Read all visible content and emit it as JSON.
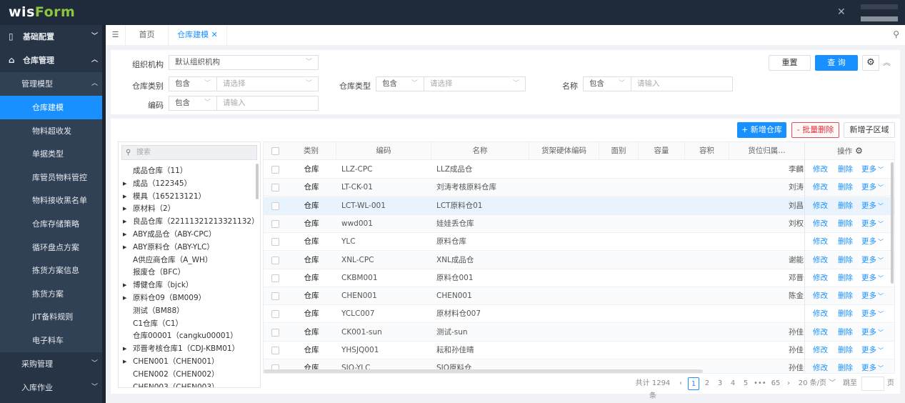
{
  "app": {
    "logo_a": "wis",
    "logo_b": "Form",
    "tool_icon": "tools-icon"
  },
  "sidebar": {
    "groups": [
      {
        "label": "基础配置"
      },
      {
        "label": "仓库管理"
      }
    ],
    "sub": "管理模型",
    "items": [
      "仓库建模",
      "物料超收发",
      "单据类型",
      "库管员物料管控",
      "物料接收黑名单",
      "仓库存储策略",
      "循环盘点方案",
      "拣货方案信息",
      "拣货方案",
      "JIT备料规则",
      "电子料车"
    ],
    "bottom": [
      "采购管理",
      "入库作业"
    ]
  },
  "tabs": {
    "home": "首页",
    "active": "仓库建模"
  },
  "filters": {
    "org_label": "组织机构",
    "org_value": "默认组织机构",
    "type_label": "仓库类别",
    "op": "包含",
    "select_ph": "请选择",
    "input_ph": "请输入",
    "wtype_label": "仓库类型",
    "name_label": "名称",
    "code_label": "编码",
    "reset": "重置",
    "query": "查 询"
  },
  "actions": {
    "add": "+ 新增仓库",
    "batch_delete": "- 批量删除",
    "add_sub": "新增子区域"
  },
  "tree": {
    "search_ph": "搜索",
    "nodes": [
      {
        "t": "成品仓库（11）",
        "c": false
      },
      {
        "t": "成品（122345）",
        "c": true
      },
      {
        "t": "模具（165213121）",
        "c": true
      },
      {
        "t": "原材料（2）",
        "c": true
      },
      {
        "t": "良品仓库（22111321213321132）",
        "c": true
      },
      {
        "t": "ABY成品仓（ABY-CPC）",
        "c": true
      },
      {
        "t": "ABY原料仓（ABY-YLC）",
        "c": true
      },
      {
        "t": "A供应商仓库（A_WH）",
        "c": false
      },
      {
        "t": "报废仓（BFC）",
        "c": false
      },
      {
        "t": "博健仓库（bjck）",
        "c": true
      },
      {
        "t": "原料仓09（BM009）",
        "c": true
      },
      {
        "t": "测试（BM88）",
        "c": false
      },
      {
        "t": "C1仓库（C1）",
        "c": false
      },
      {
        "t": "仓库00001（cangku00001）",
        "c": false
      },
      {
        "t": "邓晋考核仓库1（CDJ-KBM01）",
        "c": true
      },
      {
        "t": "CHEN001（CHEN001）",
        "c": true
      },
      {
        "t": "CHEN002（CHEN002）",
        "c": false
      },
      {
        "t": "CHEN003（CHEN003）",
        "c": false
      }
    ]
  },
  "table": {
    "headers": [
      "类别",
      "编码",
      "名称",
      "货架硬体编码",
      "面别",
      "容量",
      "容积",
      "货位归属…",
      "操作"
    ],
    "edit": "修改",
    "delete": "删除",
    "more": "更多",
    "rows": [
      [
        "仓库",
        "LLZ-CPC",
        "LLZ成品仓",
        "李麟"
      ],
      [
        "仓库",
        "LT-CK-01",
        "刘涛考核原料仓库",
        "刘涛"
      ],
      [
        "仓库",
        "LCT-WL-001",
        "LCT原料仓01",
        "刘昌"
      ],
      [
        "仓库",
        "wwd001",
        "娃娃丢仓库",
        "刘权"
      ],
      [
        "仓库",
        "YLC",
        "原料仓库",
        ""
      ],
      [
        "仓库",
        "XNL-CPC",
        "XNL成品仓",
        "谢能"
      ],
      [
        "仓库",
        "CKBM001",
        "原料仓001",
        "邓晋"
      ],
      [
        "仓库",
        "CHEN001",
        "CHEN001",
        "陈金"
      ],
      [
        "仓库",
        "YCLC007",
        "原材料仓007",
        ""
      ],
      [
        "仓库",
        "CK001-sun",
        "测试-sun",
        "孙佳"
      ],
      [
        "仓库",
        "YHSJQ001",
        "耘和孙佳晴",
        "孙佳"
      ],
      [
        "仓库",
        "SJQ-YLC",
        "SJQ原料仓",
        "孙佳"
      ]
    ]
  },
  "pagination": {
    "total": "共计 1294 条",
    "pages": [
      "1",
      "2",
      "3",
      "4",
      "5",
      "•••",
      "65"
    ],
    "size": "20 条/页",
    "jump": "跳至",
    "page_unit": "页"
  }
}
